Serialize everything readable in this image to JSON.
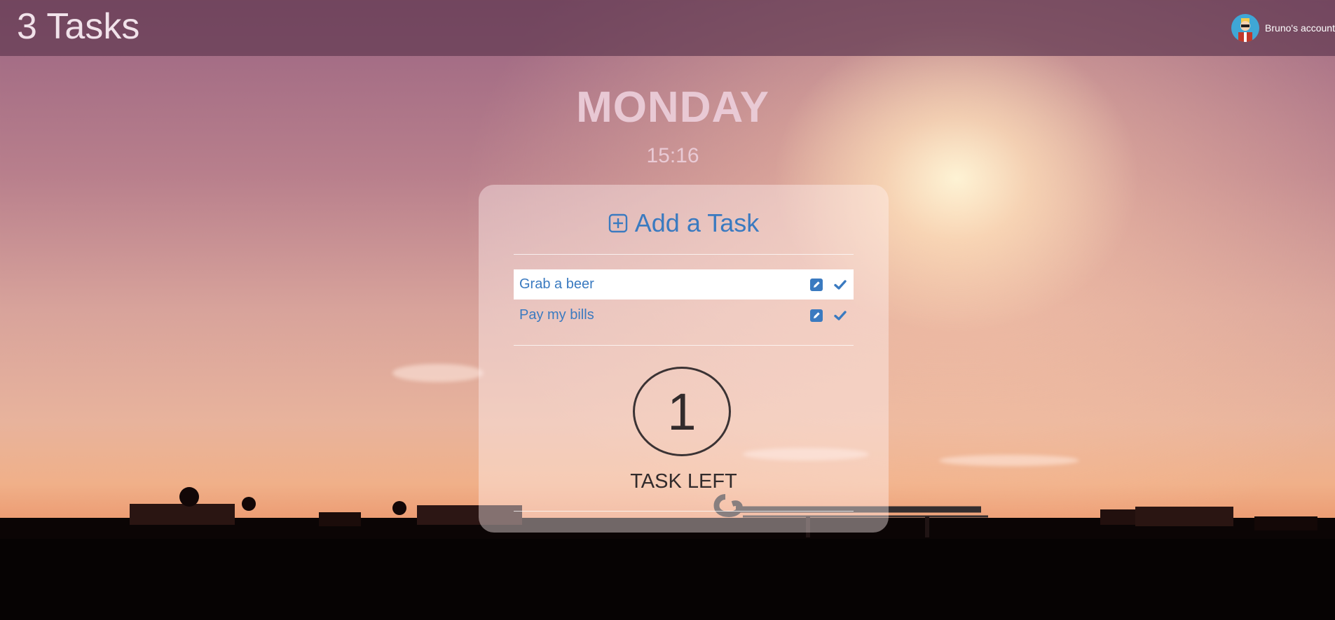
{
  "header": {
    "app_title": "3 Tasks",
    "account_label": "Bruno's account"
  },
  "clock": {
    "day": "MONDAY",
    "time": "15:16"
  },
  "card": {
    "add_task_label": "Add a Task",
    "tasks": [
      {
        "label": "Grab a beer",
        "active": true
      },
      {
        "label": "Pay my bills",
        "active": false
      }
    ],
    "tasks_left_count": "1",
    "tasks_left_label": "TASK LEFT"
  },
  "colors": {
    "accent": "#3a7ac0",
    "topbar": "#623a52",
    "counter_text": "#322b2c"
  },
  "icons": [
    "plus-square-icon",
    "edit-icon",
    "check-icon",
    "user-avatar-icon"
  ]
}
